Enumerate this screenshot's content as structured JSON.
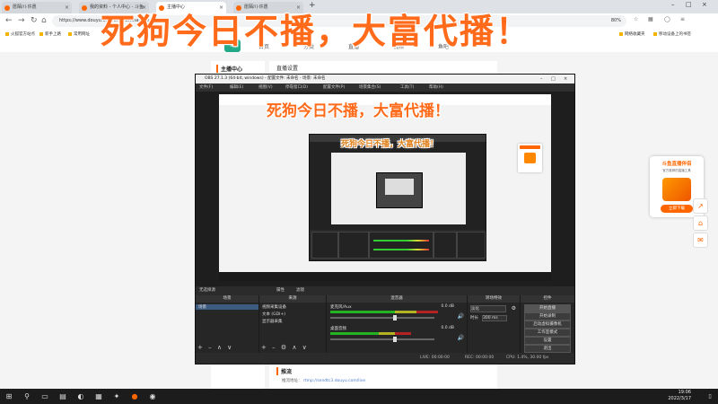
{
  "browser": {
    "tabs": [
      {
        "label": "愿陌川·许愿",
        "active": false
      },
      {
        "label": "我的资料 - 个人中心 - 斗鱼",
        "active": false
      },
      {
        "label": "主播中心",
        "active": true
      },
      {
        "label": "愿陌川·许愿",
        "active": false
      }
    ],
    "address": "https://www.douyu.com/creator/main/live",
    "zoom": "80%",
    "bookmarks_left": [
      "火狐官方站点",
      "新手上路",
      "常用网址"
    ],
    "bookmarks_right": [
      "网络收藏夹",
      "移动设备上的书签"
    ]
  },
  "site": {
    "nav": [
      "首页",
      "分类",
      "直播",
      "视频",
      "鱼吧"
    ],
    "sidebar_title": "主播中心",
    "room_settings": "直播设置",
    "rtmp_section": "推流",
    "rtmp_label": "推流地址：",
    "rtmp_value": "rtmp://sendtc3.douyu.com/live"
  },
  "ad": {
    "title": "斗鱼直播伴侣",
    "subtitle": "官方推荐的直播工具",
    "button": "立即下载"
  },
  "overlay": {
    "main": "死狗今日不播，大富代播！",
    "second": "死狗今日不播，大富代播！",
    "third": "死狗今日不播，大富代播！"
  },
  "obs": {
    "title": "OBS 27.1.3 (64-bit, windows) - 配置文件: 未命名 - 场景: 未命名",
    "menu": [
      "文件(F)",
      "编辑(E)",
      "视图(V)",
      "停靠窗口(D)",
      "配置文件(P)",
      "场景集合(S)",
      "工具(T)",
      "帮助(H)"
    ],
    "scene_bar": "无选择源",
    "scene_tabs": [
      "属性",
      "滤镜"
    ],
    "docks": {
      "scenes": "场景",
      "sources": "来源",
      "mixer": "混音器",
      "transitions": "转场特效",
      "controls": "控件"
    },
    "scene_items": [
      "场景"
    ],
    "source_items": [
      "视频采集设备",
      "文本 (GDI+)",
      "显示器采集"
    ],
    "mixer": [
      {
        "name": "麦克风/Aux",
        "db": "0.0 dB"
      },
      {
        "name": "桌面音频",
        "db": "0.0 dB"
      }
    ],
    "transition": {
      "type": "淡化",
      "duration_label": "时长",
      "duration_value": "300 ms"
    },
    "controls": [
      "开始直播",
      "开始录制",
      "启动虚拟摄像机",
      "工作室模式",
      "设置",
      "退出"
    ],
    "status": {
      "live": "LIVE: 00:00:00",
      "rec": "REC: 00:00:00",
      "cpu": "CPU: 1.4%, 30.00 fps"
    }
  },
  "taskbar": {
    "time": "19:06",
    "date": "2022/3/17"
  }
}
